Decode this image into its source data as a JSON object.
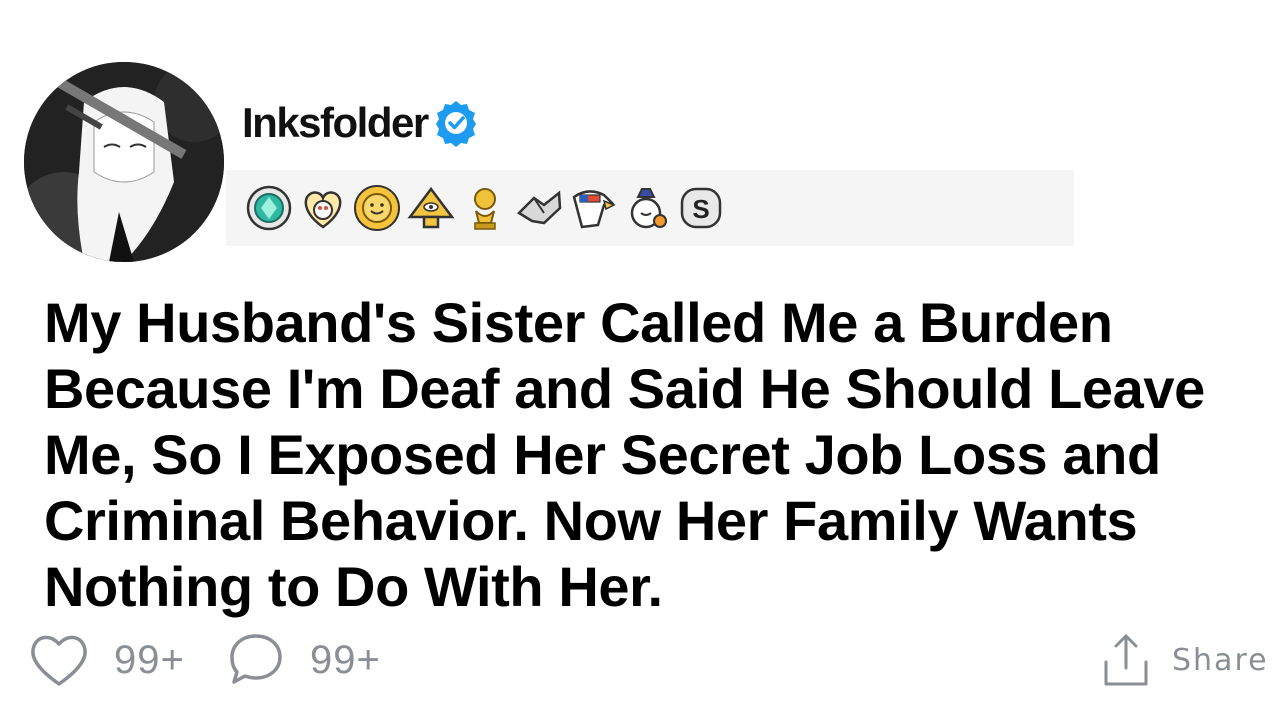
{
  "post": {
    "author": {
      "username": "Inksfolder",
      "verified": true,
      "avatar_icon": "anime-character-avatar"
    },
    "awards": [
      "diamond-award-icon",
      "heart-eyes-award-icon",
      "sun-award-icon",
      "pyramid-eye-award-icon",
      "gold-trophy-award-icon",
      "handshake-award-icon",
      "eagle-award-icon",
      "bubble-award-icon",
      "silver-s-award-icon"
    ],
    "title": "My Husband's Sister Called Me a Burden Because I'm Deaf and Said He Should Leave Me, So I Exposed Her Secret Job Loss and Criminal Behavior. Now Her Family Wants Nothing to Do With Her.",
    "actions": {
      "likes": "99+",
      "comments": "99+",
      "share_label": "Share"
    }
  },
  "colors": {
    "verified_blue": "#1d9bf0",
    "count_gray": "#8a8f96",
    "awards_bg": "#f5f5f5",
    "title_black": "#000000"
  }
}
